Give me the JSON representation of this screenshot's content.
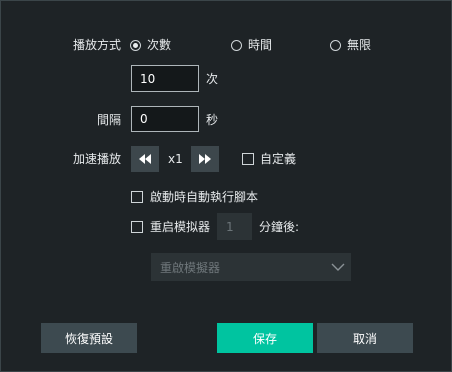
{
  "playback": {
    "mode_label": "播放方式",
    "options": [
      {
        "label": "次數",
        "selected": true
      },
      {
        "label": "時間",
        "selected": false
      },
      {
        "label": "無限",
        "selected": false
      }
    ],
    "count_value": "10",
    "count_unit": "次"
  },
  "interval": {
    "label": "間隔",
    "value": "0",
    "unit": "秒"
  },
  "speed": {
    "label": "加速播放",
    "value": "x1",
    "custom_label": "自定義",
    "custom_checked": false
  },
  "autorun": {
    "label": "啟動時自動執行腳本",
    "checked": false
  },
  "restart": {
    "label": "重启模拟器",
    "checked": false,
    "value": "1",
    "unit": "分鐘後:",
    "select_value": "重啟模擬器"
  },
  "footer": {
    "reset_label": "恢復預設",
    "save_label": "保存",
    "cancel_label": "取消"
  },
  "colors": {
    "background": "#1e2326",
    "primary": "#00c4a0",
    "button_gray": "#3d4a50"
  }
}
